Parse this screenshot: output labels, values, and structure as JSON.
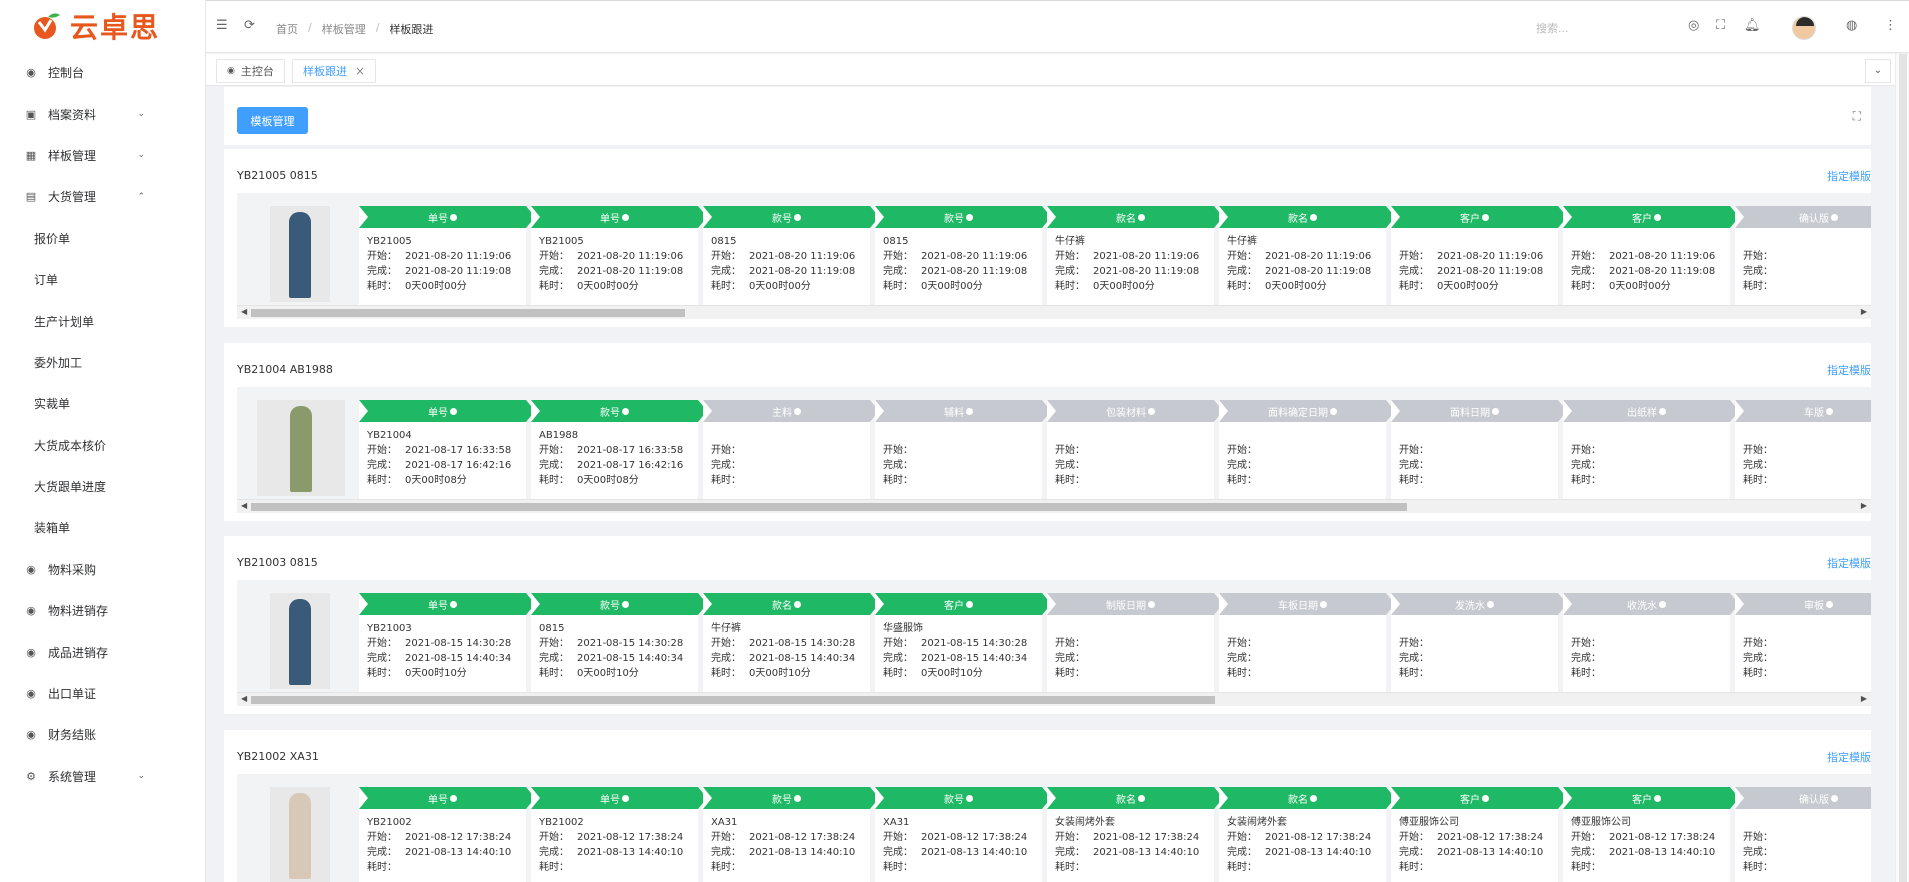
{
  "app": {
    "name": "云卓思"
  },
  "sidebar": {
    "items": [
      {
        "label": "控制台",
        "icon": "dashboard-icon",
        "glyph": "◉",
        "type": "item"
      },
      {
        "label": "档案资料",
        "icon": "archive-icon",
        "glyph": "▣",
        "type": "item",
        "arrow": "⌄"
      },
      {
        "label": "样板管理",
        "icon": "sample-icon",
        "glyph": "▦",
        "type": "item",
        "arrow": "⌄"
      },
      {
        "label": "大货管理",
        "icon": "bulk-icon",
        "glyph": "▤",
        "type": "item",
        "arrow": "⌃"
      },
      {
        "label": "报价单",
        "type": "sub"
      },
      {
        "label": "订单",
        "type": "sub"
      },
      {
        "label": "生产计划单",
        "type": "sub"
      },
      {
        "label": "委外加工",
        "type": "sub"
      },
      {
        "label": "实裁单",
        "type": "sub"
      },
      {
        "label": "大货成本核价",
        "type": "sub"
      },
      {
        "label": "大货跟单进度",
        "type": "sub"
      },
      {
        "label": "装箱单",
        "type": "sub"
      },
      {
        "label": "物料采购",
        "icon": "purchase-icon",
        "glyph": "◉",
        "type": "item"
      },
      {
        "label": "物料进销存",
        "icon": "inventory-icon",
        "glyph": "◉",
        "type": "item"
      },
      {
        "label": "成品进销存",
        "icon": "product-icon",
        "glyph": "◉",
        "type": "item"
      },
      {
        "label": "出口单证",
        "icon": "export-icon",
        "glyph": "◉",
        "type": "item"
      },
      {
        "label": "财务结账",
        "icon": "finance-icon",
        "glyph": "◉",
        "type": "item"
      },
      {
        "label": "系统管理",
        "icon": "settings-icon",
        "glyph": "⚙",
        "type": "item",
        "arrow": "⌄"
      }
    ]
  },
  "header": {
    "breadcrumb": [
      "首页",
      "样板管理",
      "样板跟进"
    ],
    "search_placeholder": "搜索..."
  },
  "tabs": [
    {
      "label": "主控台",
      "active": false
    },
    {
      "label": "样板跟进",
      "active": true,
      "close": "×"
    }
  ],
  "toolbar": {
    "button_label": "模板管理"
  },
  "cards": [
    {
      "title": "YB21005 0815",
      "link": "指定模版",
      "thumb_color": "#3a5a7a",
      "thumb_wide": false,
      "scroll_thumb_fraction": 0.27,
      "steps": [
        {
          "name": "单号",
          "done": true,
          "value": "YB21005",
          "start": "2021-08-20 11:19:06",
          "finish": "2021-08-20 11:19:08",
          "elapsed": "0天00时00分"
        },
        {
          "name": "单号",
          "done": true,
          "value": "YB21005",
          "start": "2021-08-20 11:19:06",
          "finish": "2021-08-20 11:19:08",
          "elapsed": "0天00时00分"
        },
        {
          "name": "款号",
          "done": true,
          "value": "0815",
          "start": "2021-08-20 11:19:06",
          "finish": "2021-08-20 11:19:08",
          "elapsed": "0天00时00分"
        },
        {
          "name": "款号",
          "done": true,
          "value": "0815",
          "start": "2021-08-20 11:19:06",
          "finish": "2021-08-20 11:19:08",
          "elapsed": "0天00时00分"
        },
        {
          "name": "款名",
          "done": true,
          "value": "牛仔裤",
          "start": "2021-08-20 11:19:06",
          "finish": "2021-08-20 11:19:08",
          "elapsed": "0天00时00分"
        },
        {
          "name": "款名",
          "done": true,
          "value": "牛仔裤",
          "start": "2021-08-20 11:19:06",
          "finish": "2021-08-20 11:19:08",
          "elapsed": "0天00时00分"
        },
        {
          "name": "客户",
          "done": true,
          "value": "",
          "start": "2021-08-20 11:19:06",
          "finish": "2021-08-20 11:19:08",
          "elapsed": "0天00时00分"
        },
        {
          "name": "客户",
          "done": true,
          "value": "",
          "start": "2021-08-20 11:19:06",
          "finish": "2021-08-20 11:19:08",
          "elapsed": "0天00时00分"
        },
        {
          "name": "确认版",
          "done": false,
          "value": "",
          "start": "",
          "finish": "",
          "elapsed": ""
        }
      ]
    },
    {
      "title": "YB21004 AB1988",
      "link": "指定模版",
      "thumb_color": "#8a9a6a",
      "thumb_wide": true,
      "scroll_thumb_fraction": 0.72,
      "steps": [
        {
          "name": "单号",
          "done": true,
          "value": "YB21004",
          "start": "2021-08-17 16:33:58",
          "finish": "2021-08-17 16:42:16",
          "elapsed": "0天00时08分"
        },
        {
          "name": "款号",
          "done": true,
          "value": "AB1988",
          "start": "2021-08-17 16:33:58",
          "finish": "2021-08-17 16:42:16",
          "elapsed": "0天00时08分"
        },
        {
          "name": "主料",
          "done": false,
          "value": "",
          "start": "",
          "finish": "",
          "elapsed": ""
        },
        {
          "name": "辅料",
          "done": false,
          "value": "",
          "start": "",
          "finish": "",
          "elapsed": ""
        },
        {
          "name": "包装材料",
          "done": false,
          "value": "",
          "start": "",
          "finish": "",
          "elapsed": ""
        },
        {
          "name": "面料确定日期",
          "done": false,
          "value": "",
          "start": "",
          "finish": "",
          "elapsed": ""
        },
        {
          "name": "面料日期",
          "done": false,
          "value": "",
          "start": "",
          "finish": "",
          "elapsed": ""
        },
        {
          "name": "出纸样",
          "done": false,
          "value": "",
          "start": "",
          "finish": "",
          "elapsed": ""
        },
        {
          "name": "车版",
          "done": false,
          "value": "",
          "start": "",
          "finish": "",
          "elapsed": ""
        }
      ]
    },
    {
      "title": "YB21003 0815",
      "link": "指定模版",
      "thumb_color": "#3a5a7a",
      "thumb_wide": false,
      "scroll_thumb_fraction": 0.6,
      "steps": [
        {
          "name": "单号",
          "done": true,
          "value": "YB21003",
          "start": "2021-08-15 14:30:28",
          "finish": "2021-08-15 14:40:34",
          "elapsed": "0天00时10分"
        },
        {
          "name": "款号",
          "done": true,
          "value": "0815",
          "start": "2021-08-15 14:30:28",
          "finish": "2021-08-15 14:40:34",
          "elapsed": "0天00时10分"
        },
        {
          "name": "款名",
          "done": true,
          "value": "牛仔裤",
          "start": "2021-08-15 14:30:28",
          "finish": "2021-08-15 14:40:34",
          "elapsed": "0天00时10分"
        },
        {
          "name": "客户",
          "done": true,
          "value": "华盛服饰",
          "start": "2021-08-15 14:30:28",
          "finish": "2021-08-15 14:40:34",
          "elapsed": "0天00时10分"
        },
        {
          "name": "制版日期",
          "done": false,
          "value": "",
          "start": "",
          "finish": "",
          "elapsed": ""
        },
        {
          "name": "车板日期",
          "done": false,
          "value": "",
          "start": "",
          "finish": "",
          "elapsed": ""
        },
        {
          "name": "发洗水",
          "done": false,
          "value": "",
          "start": "",
          "finish": "",
          "elapsed": ""
        },
        {
          "name": "收洗水",
          "done": false,
          "value": "",
          "start": "",
          "finish": "",
          "elapsed": ""
        },
        {
          "name": "审板",
          "done": false,
          "value": "",
          "start": "",
          "finish": "",
          "elapsed": ""
        }
      ]
    },
    {
      "title": "YB21002 XA31",
      "link": "指定模版",
      "thumb_color": "#d8c8b8",
      "thumb_wide": false,
      "scroll_thumb_fraction": 0.5,
      "steps": [
        {
          "name": "单号",
          "done": true,
          "value": "YB21002",
          "start": "2021-08-12 17:38:24",
          "finish": "2021-08-13 14:40:10",
          "elapsed": ""
        },
        {
          "name": "单号",
          "done": true,
          "value": "YB21002",
          "start": "2021-08-12 17:38:24",
          "finish": "2021-08-13 14:40:10",
          "elapsed": ""
        },
        {
          "name": "款号",
          "done": true,
          "value": "XA31",
          "start": "2021-08-12 17:38:24",
          "finish": "2021-08-13 14:40:10",
          "elapsed": ""
        },
        {
          "name": "款号",
          "done": true,
          "value": "XA31",
          "start": "2021-08-12 17:38:24",
          "finish": "2021-08-13 14:40:10",
          "elapsed": ""
        },
        {
          "name": "款名",
          "done": true,
          "value": "女装闹烤外套",
          "start": "2021-08-12 17:38:24",
          "finish": "2021-08-13 14:40:10",
          "elapsed": ""
        },
        {
          "name": "款名",
          "done": true,
          "value": "女装闹烤外套",
          "start": "2021-08-12 17:38:24",
          "finish": "2021-08-13 14:40:10",
          "elapsed": ""
        },
        {
          "name": "客户",
          "done": true,
          "value": "傅亚服饰公司",
          "start": "2021-08-12 17:38:24",
          "finish": "2021-08-13 14:40:10",
          "elapsed": ""
        },
        {
          "name": "客户",
          "done": true,
          "value": "傅亚服饰公司",
          "start": "2021-08-12 17:38:24",
          "finish": "2021-08-13 14:40:10",
          "elapsed": ""
        },
        {
          "name": "确认版",
          "done": false,
          "value": "",
          "start": "",
          "finish": "",
          "elapsed": ""
        }
      ]
    }
  ],
  "labels": {
    "start": "开始：",
    "finish": "完成：",
    "elapsed": "耗时："
  },
  "colors": {
    "accent": "#409eff",
    "done": "#1fb965",
    "pending": "#c6c9cf",
    "brand": "#e8571e"
  }
}
